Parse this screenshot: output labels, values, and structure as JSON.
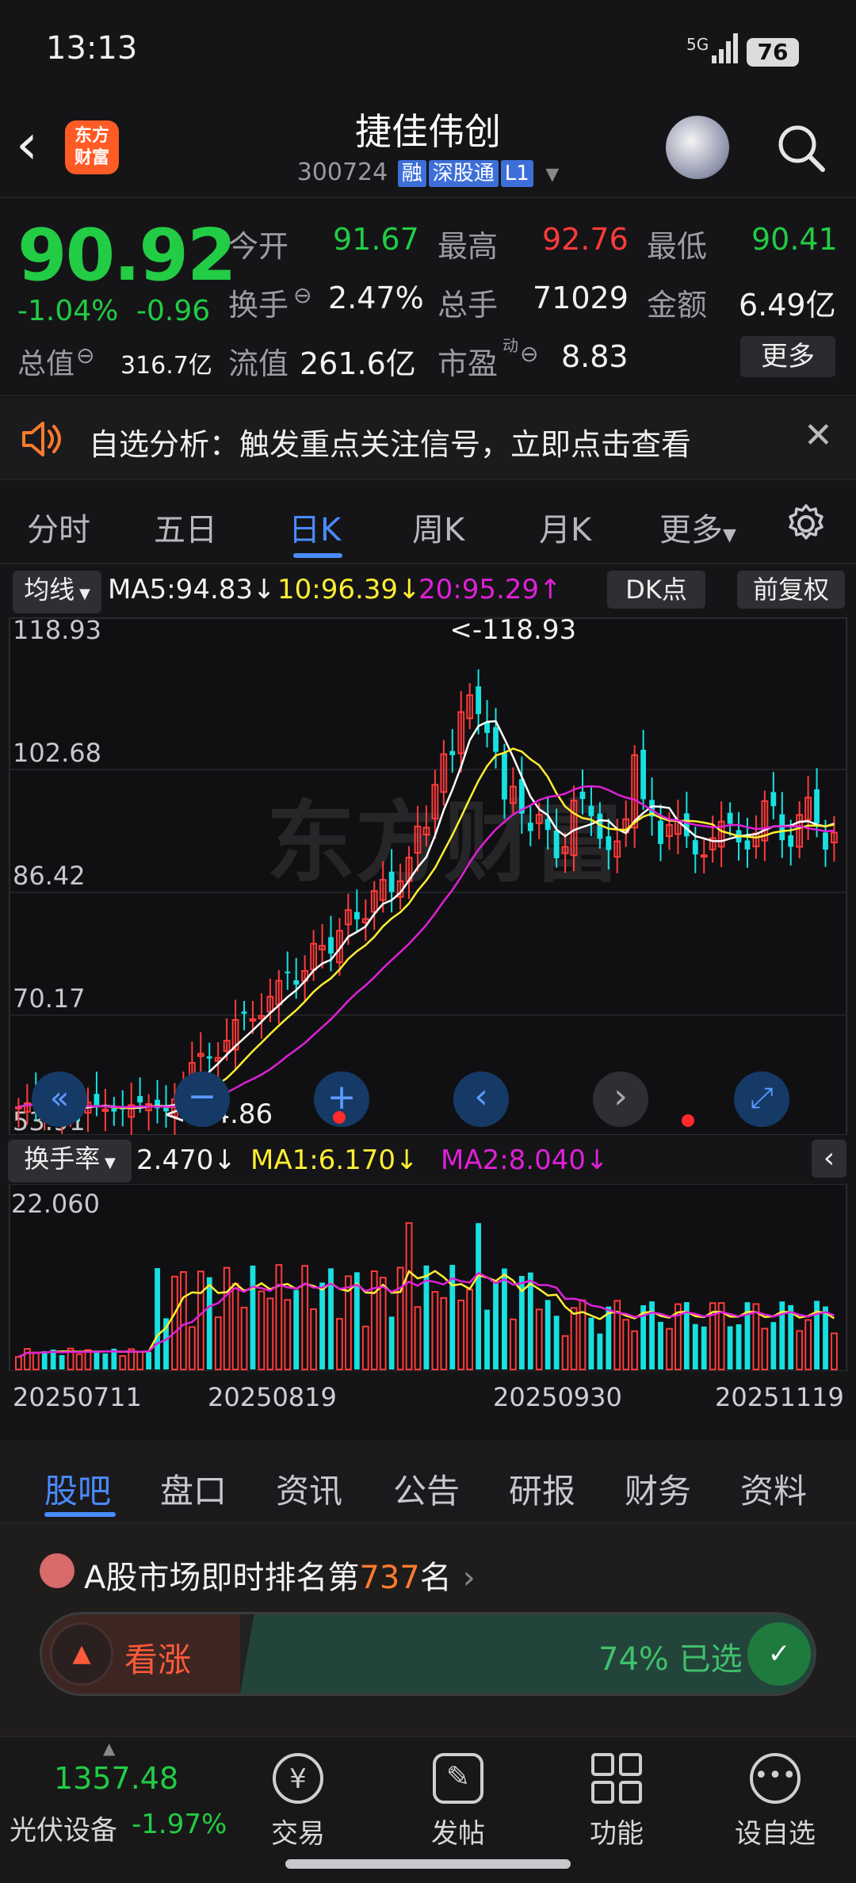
{
  "status": {
    "time": "13:13",
    "network": "5G",
    "battery": "76"
  },
  "header": {
    "title": "捷佳伟创",
    "code": "300724",
    "tags": [
      "融",
      "深股通",
      "L1"
    ],
    "logo_line1": "东方",
    "logo_line2": "财富"
  },
  "quote": {
    "price": "90.92",
    "change_pct": "-1.04%",
    "change": "-0.96",
    "open_label": "今开",
    "open": "91.67",
    "high_label": "最高",
    "high": "92.76",
    "low_label": "最低",
    "low": "90.41",
    "turnover_label": "换手",
    "turnover": "2.47%",
    "volume_label": "总手",
    "volume": "71029",
    "amount_label": "金额",
    "amount": "6.49亿",
    "mktcap_label": "总值",
    "mktcap": "316.7亿",
    "float_label": "流值",
    "float": "261.6亿",
    "pe_label": "市盈",
    "pe_sup": "动",
    "pe": "8.83",
    "more_label": "更多"
  },
  "notice": {
    "text": "自选分析：触发重点关注信号，立即点击查看"
  },
  "ktabs": {
    "items": [
      "分时",
      "五日",
      "日K",
      "周K",
      "月K",
      "更多"
    ],
    "active": "日K"
  },
  "ma_bar": {
    "selector": "均线",
    "ma5": "MA5:94.83",
    "ma10": "10:96.39",
    "ma20": "20:95.29",
    "dk": "DK点",
    "adjust": "前复权"
  },
  "turn_bar": {
    "selector": "换手率",
    "value": "2.470",
    "ma1": "MA1:6.170",
    "ma2": "MA2:8.040"
  },
  "chart_data": {
    "type": "candlestick",
    "y_ticks": [
      "118.93",
      "102.68",
      "86.42",
      "70.17",
      "53.91"
    ],
    "ylim": [
      53.91,
      118.93
    ],
    "max_annotation": "<-118.93",
    "min_annotation": "<-54.86",
    "watermark": "东方财富",
    "vol_tick": "22.060",
    "x_ticks": [
      "20250711",
      "20250819",
      "20250930",
      "20251119"
    ],
    "colors": {
      "up": "#ff3b3b",
      "down": "#18e0e0",
      "ma5": "#ffffff",
      "ma10": "#ffee33",
      "ma20": "#e020d8"
    }
  },
  "bottom_tabs": {
    "items": [
      "股吧",
      "盘口",
      "资讯",
      "公告",
      "研报",
      "财务",
      "资料"
    ],
    "active": "股吧"
  },
  "rank": {
    "prefix": "A股市场即时排名第",
    "num": "737",
    "suffix": "名",
    "bull": "看涨",
    "pct": "74% 已选"
  },
  "bottom_nav": {
    "index_value": "1357.48",
    "index_name": "光伏设备",
    "index_change": "-1.97%",
    "items": [
      "交易",
      "发帖",
      "功能",
      "设自选"
    ]
  }
}
